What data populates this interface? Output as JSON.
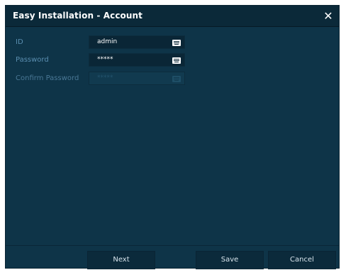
{
  "window": {
    "title": "Easy Installation - Account",
    "close_label": "✕"
  },
  "fields": [
    {
      "label": "ID",
      "value": "admin",
      "icon": "keyboard-icon",
      "enabled": true
    },
    {
      "label": "Password",
      "value": "*****",
      "icon": "keyboard-icon",
      "enabled": true
    },
    {
      "label": "Confirm Password",
      "value": "*****",
      "icon": "keyboard-icon",
      "enabled": false
    }
  ],
  "buttons": {
    "next": "Next",
    "save": "Save",
    "cancel": "Cancel"
  },
  "colors": {
    "dialog_bg": "#0e3448",
    "titlebar_bg": "#0b2939",
    "label": "#5a8eb0",
    "input_bg": "#0a2636"
  }
}
